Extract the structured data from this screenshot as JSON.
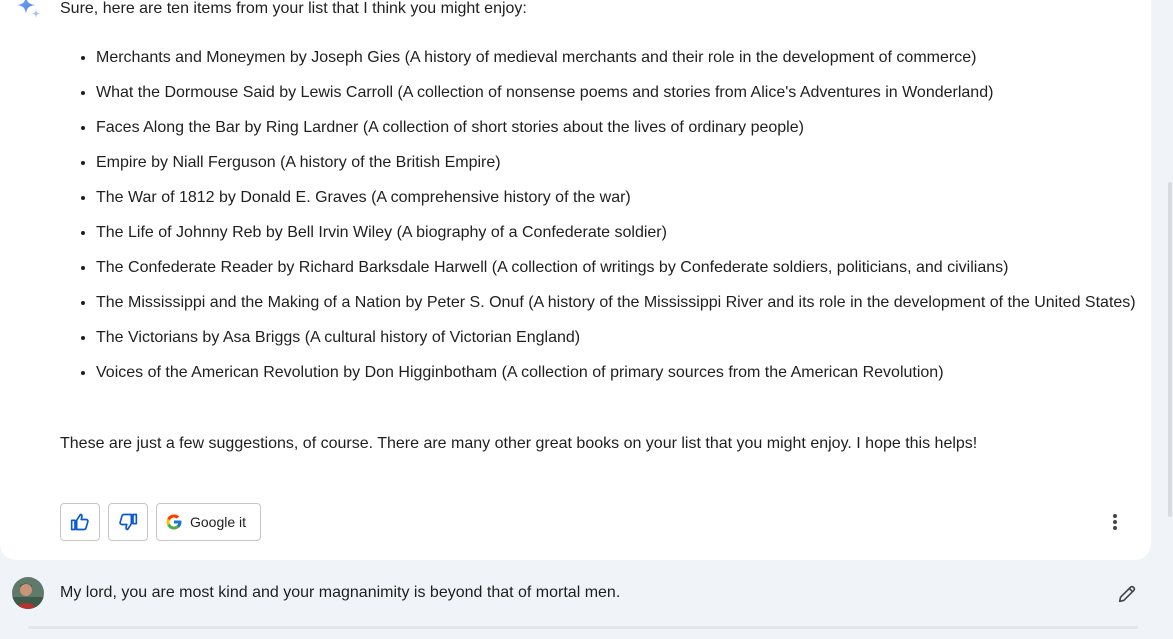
{
  "response": {
    "intro": "Sure, here are ten items from your list that I think you might enjoy:",
    "items": [
      "Merchants and Moneymen by Joseph Gies (A history of medieval merchants and their role in the development of commerce)",
      "What the Dormouse Said by Lewis Carroll (A collection of nonsense poems and stories from Alice's Adventures in Wonderland)",
      "Faces Along the Bar by Ring Lardner (A collection of short stories about the lives of ordinary people)",
      "Empire by Niall Ferguson (A history of the British Empire)",
      "The War of 1812 by Donald E. Graves (A comprehensive history of the war)",
      "The Life of Johnny Reb by Bell Irvin Wiley (A biography of a Confederate soldier)",
      "The Confederate Reader by Richard Barksdale Harwell (A collection of writings by Confederate soldiers, politicians, and civilians)",
      "The Mississippi and the Making of a Nation by Peter S. Onuf (A history of the Mississippi River and its role in the development of the United States)",
      "The Victorians by Asa Briggs (A cultural history of Victorian England)",
      "Voices of the American Revolution by Don Higginbotham (A collection of primary sources from the American Revolution)"
    ],
    "outro": "These are just a few suggestions, of course. There are many other great books on your list that you might enjoy. I hope this helps!"
  },
  "actions": {
    "thumbs_up_icon": "thumbs-up-icon",
    "thumbs_down_icon": "thumbs-down-icon",
    "google_it_label": "Google it",
    "more_icon": "more-vert-icon"
  },
  "user_turn": {
    "message": "My lord, you are most kind and your magnanimity is beyond that of mortal men.",
    "edit_icon": "pencil-icon"
  },
  "colors": {
    "accent_blue": "#0b57d0",
    "text": "#1f1f1f",
    "page_bg": "#f0f4f9",
    "card_bg": "#ffffff"
  }
}
